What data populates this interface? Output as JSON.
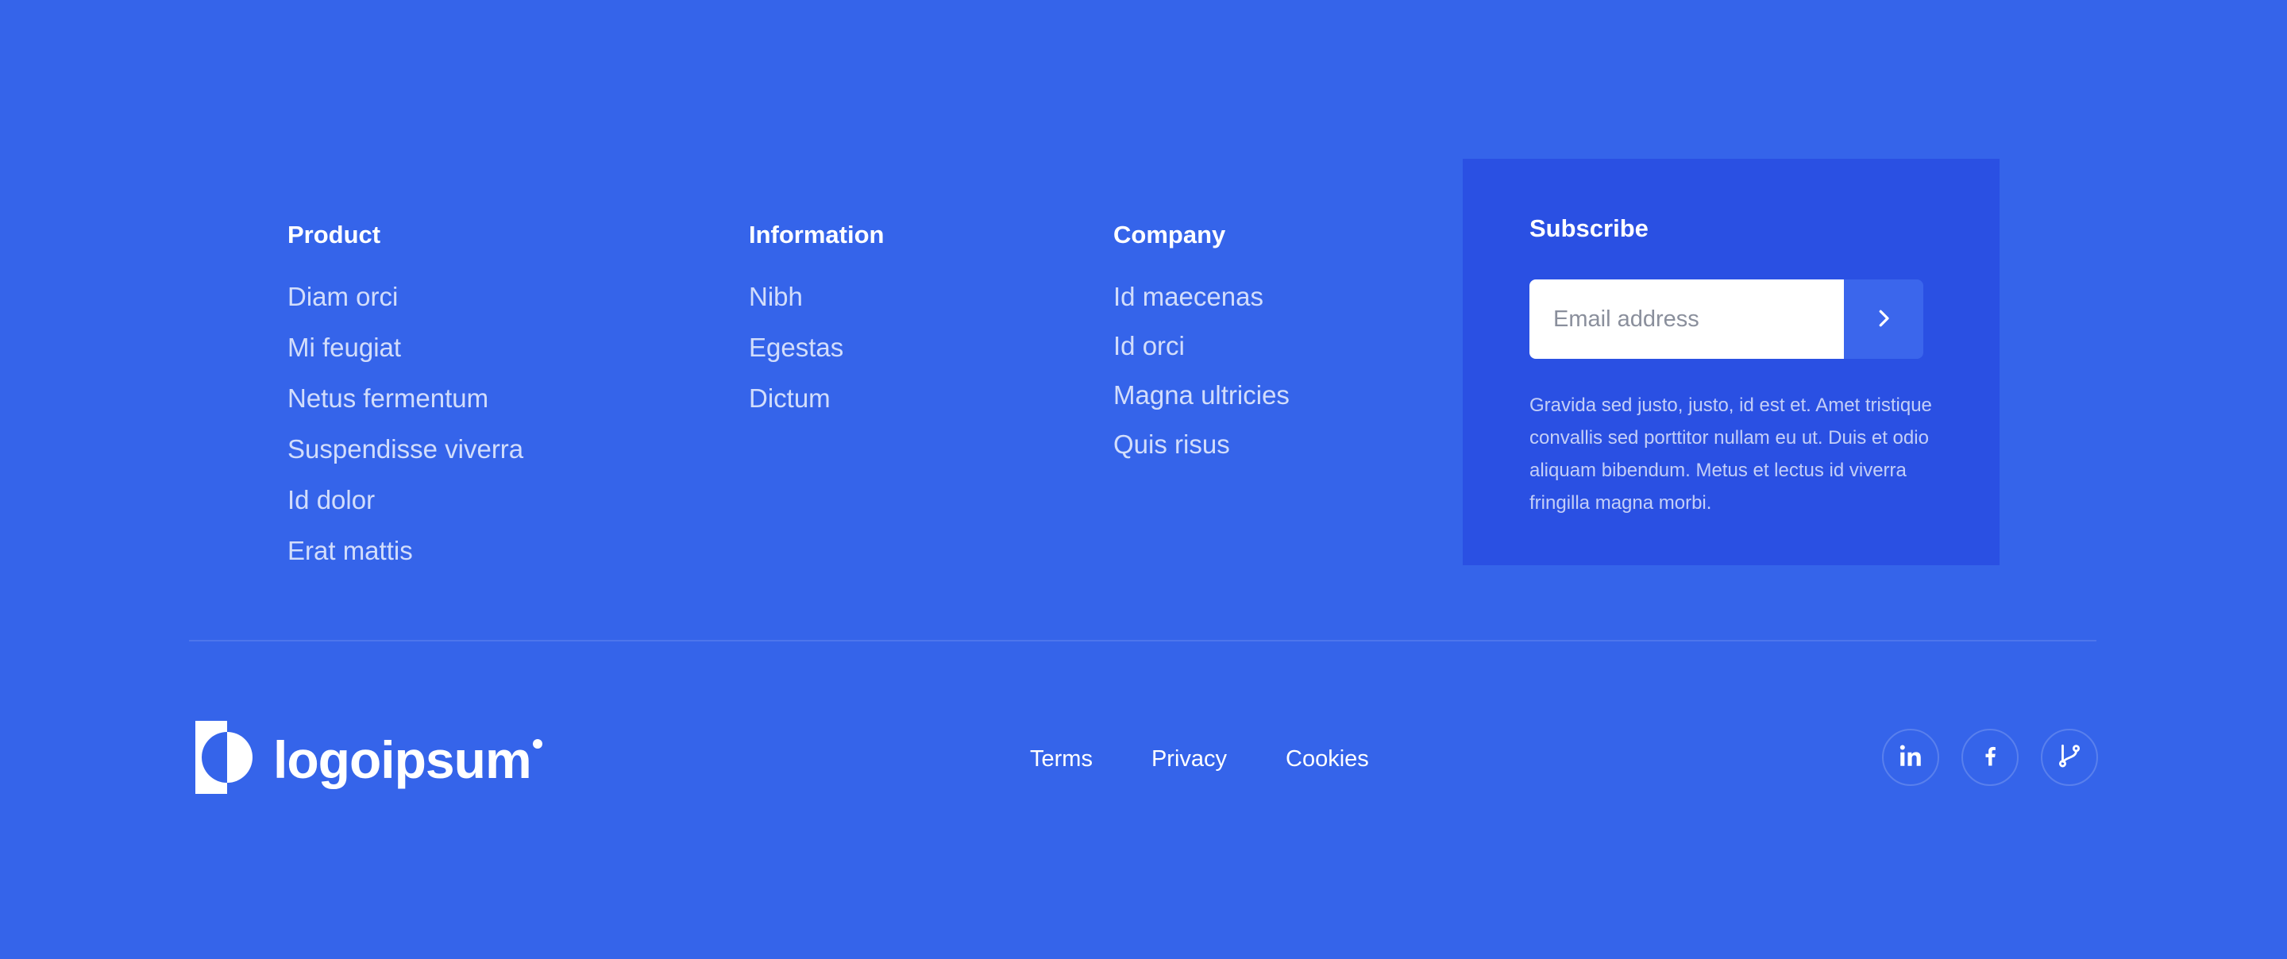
{
  "columns": {
    "product": {
      "title": "Product",
      "items": [
        "Diam orci",
        "Mi feugiat",
        "Netus fermentum",
        "Suspendisse viverra",
        "Id dolor",
        "Erat mattis"
      ]
    },
    "information": {
      "title": "Information",
      "items": [
        "Nibh",
        "Egestas",
        "Dictum"
      ]
    },
    "company": {
      "title": "Company",
      "items": [
        "Id maecenas",
        "Id orci",
        "Magna ultricies",
        "Quis risus"
      ]
    }
  },
  "subscribe": {
    "title": "Subscribe",
    "email_placeholder": "Email address",
    "email_value": "",
    "submit_icon": "chevron-right-icon",
    "description": "Gravida sed justo, justo, id est et. Amet tristique convallis sed porttitor nullam eu ut. Duis et odio aliquam bibendum. Metus et lectus id viverra fringilla magna morbi."
  },
  "logo": {
    "text": "logoipsum",
    "icon": "logo-mark-icon"
  },
  "bottom_links": [
    "Terms",
    "Privacy",
    "Cookies"
  ],
  "social": [
    {
      "name": "linkedin",
      "icon": "linkedin-icon"
    },
    {
      "name": "facebook",
      "icon": "facebook-icon"
    },
    {
      "name": "git",
      "icon": "git-branch-icon"
    }
  ],
  "colors": {
    "background": "#3564EA",
    "card": "#2A50E3",
    "button": "#3B66EC",
    "text": "#FFFFFF"
  }
}
